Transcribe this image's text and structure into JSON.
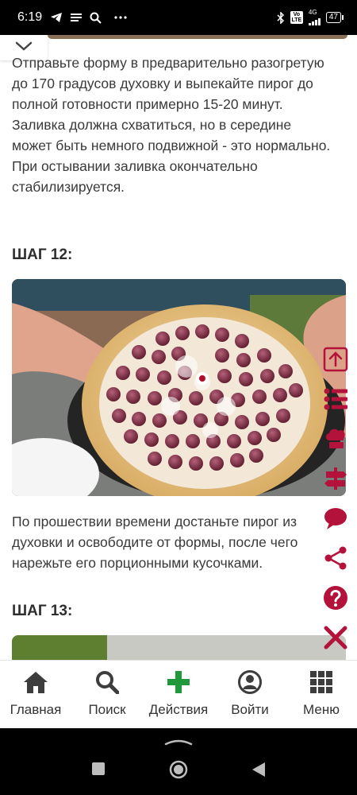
{
  "status_bar": {
    "time": "6:19",
    "network": "4G",
    "volte": "Vo LTE",
    "battery": "47"
  },
  "content": {
    "step11_text": "Отправьте форму в предварительно разогретую до 170 градусов духовку и выпекайте пирог до полной готовности примерно 15-20 минут. Заливка должна схватиться, но в середине может быть немного подвижной - это нормально. При остывании заливка окончательно стабилизируется.",
    "step12_title": "ШАГ 12:",
    "step12_text": "По прошествии времени достаньте пирог из духовки и освободите от формы, после чего нарежьте его порционными кусочками.",
    "step13_title": "ШАГ 13:"
  },
  "side_tools": [
    {
      "icon": "arrow-up-square-icon"
    },
    {
      "icon": "list-icon"
    },
    {
      "icon": "chef-hat-icon"
    },
    {
      "icon": "signpost-icon"
    },
    {
      "icon": "comment-icon"
    },
    {
      "icon": "share-icon"
    },
    {
      "icon": "help-icon"
    },
    {
      "icon": "close-icon"
    }
  ],
  "bottom_nav": {
    "home": "Главная",
    "search": "Поиск",
    "actions": "Действия",
    "login": "Войти",
    "menu": "Меню"
  },
  "colors": {
    "accent": "#b3123a",
    "plus_green": "#1e9a3a",
    "nav_icon": "#3d3d3d"
  }
}
